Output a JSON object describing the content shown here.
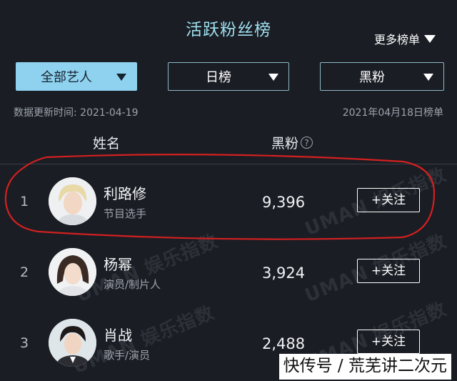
{
  "header": {
    "title": "活跃粉丝榜",
    "more_label": "更多榜单"
  },
  "filters": [
    {
      "label": "全部艺人",
      "active": true
    },
    {
      "label": "日榜",
      "active": false
    },
    {
      "label": "黑粉",
      "active": false
    }
  ],
  "meta": {
    "update_time": "数据更新时间: 2021-04-19",
    "rank_date": "2021年04月18日榜单"
  },
  "columns": {
    "name": "姓名",
    "score": "黑粉",
    "help": "?"
  },
  "rows": [
    {
      "rank": "1",
      "name": "利路修",
      "role": "节目选手",
      "score": "9,396",
      "follow": "+关注"
    },
    {
      "rank": "2",
      "name": "杨幂",
      "role": "演员/制片人",
      "score": "3,924",
      "follow": "+关注"
    },
    {
      "rank": "3",
      "name": "肖战",
      "role": "歌手/演员",
      "score": "2,488",
      "follow": "+关注"
    }
  ],
  "watermark": "UMAN 娱乐指数",
  "footer_credit": "快传号 / 荒芜讲二次元",
  "colors": {
    "background": "#1a1d24",
    "title": "#9fe0ee",
    "active_filter": "#8fd2ef",
    "highlight_ring": "#d32020"
  }
}
